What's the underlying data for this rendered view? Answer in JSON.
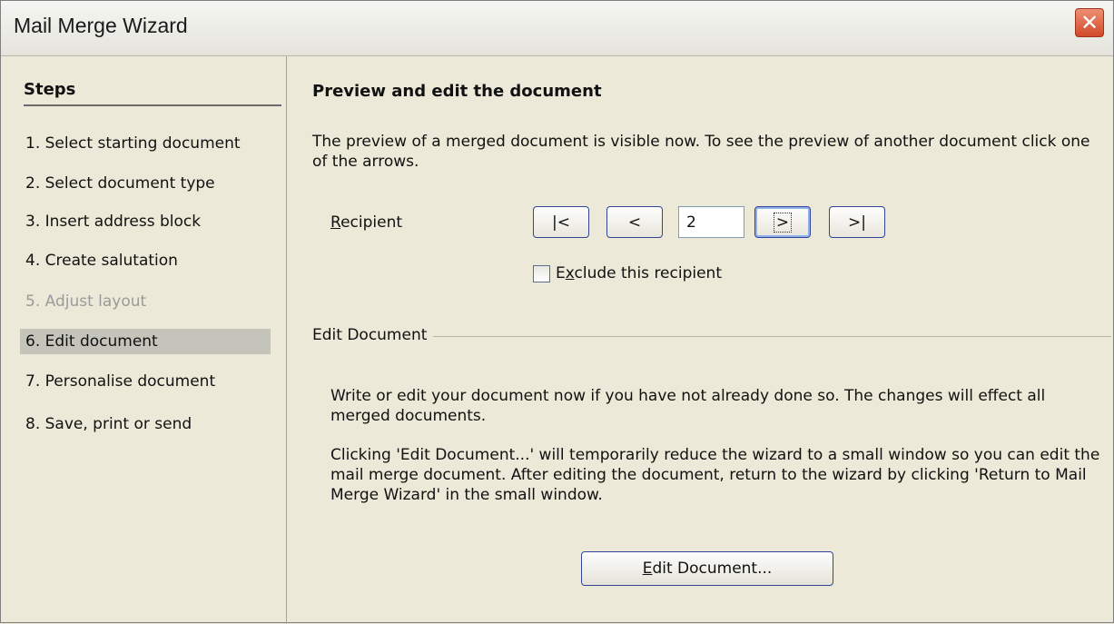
{
  "window": {
    "title": "Mail Merge Wizard",
    "close_glyph": "✕"
  },
  "sidebar": {
    "title": "Steps",
    "items": [
      {
        "label": "1.  Select starting document",
        "state": "normal"
      },
      {
        "label": "2.  Select document type",
        "state": "normal"
      },
      {
        "label": "3.  Insert address block",
        "state": "normal"
      },
      {
        "label": "4.  Create salutation",
        "state": "normal"
      },
      {
        "label": "5.  Adjust layout",
        "state": "disabled"
      },
      {
        "label": "6.  Edit document",
        "state": "active"
      },
      {
        "label": "7.  Personalise document",
        "state": "normal"
      },
      {
        "label": "8.  Save, print or send",
        "state": "normal"
      }
    ]
  },
  "main": {
    "heading": "Preview and edit the document",
    "description": "The preview of a merged document is visible now. To see the preview of another document click one of the arrows.",
    "recipient": {
      "label_first": "R",
      "label_rest": "ecipient",
      "first_label": "|<",
      "prev_label": "<",
      "value": "2",
      "next_label": ">",
      "last_label": ">|"
    },
    "exclude": {
      "label_pre": "E",
      "label_mnemonic": "x",
      "label_post": "clude this recipient",
      "checked": false
    },
    "edit_group": {
      "label": "Edit Document",
      "para1": "Write or edit your document now if you have not already done so. The changes will effect all merged documents.",
      "para2": "Clicking 'Edit Document...' will temporarily reduce the wizard to a small window so you can edit the mail merge document. After editing the document, return to the wizard by clicking 'Return to Mail Merge Wizard' in the small window.",
      "button_mnemonic": "E",
      "button_rest": "dit Document..."
    }
  }
}
